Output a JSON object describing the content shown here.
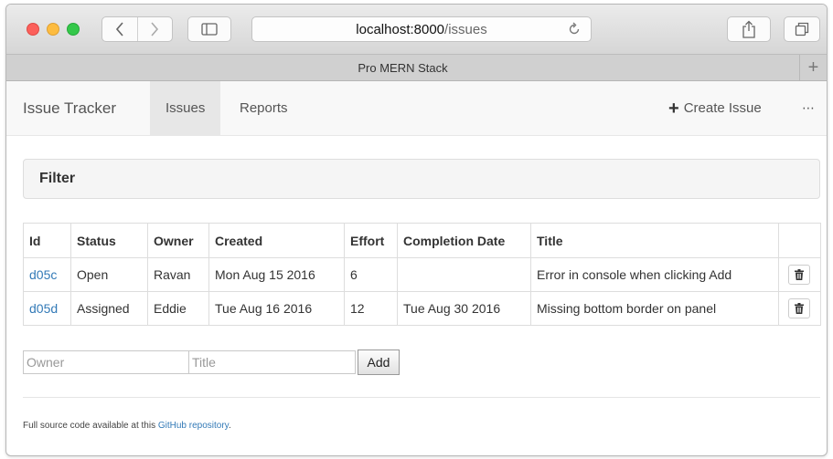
{
  "browser": {
    "url_host": "localhost:8000",
    "url_path": "/issues",
    "tab_title": "Pro MERN Stack",
    "new_tab": "+"
  },
  "app": {
    "brand": "Issue Tracker",
    "nav": {
      "issues": "Issues",
      "reports": "Reports",
      "create_issue": "Create Issue",
      "more": "⋯"
    },
    "filter": {
      "title": "Filter"
    },
    "table": {
      "headers": [
        "Id",
        "Status",
        "Owner",
        "Created",
        "Effort",
        "Completion Date",
        "Title"
      ],
      "rows": [
        {
          "id": "d05c",
          "status": "Open",
          "owner": "Ravan",
          "created": "Mon Aug 15 2016",
          "effort": "6",
          "completion_date": "",
          "title": "Error in console when clicking Add"
        },
        {
          "id": "d05d",
          "status": "Assigned",
          "owner": "Eddie",
          "created": "Tue Aug 16 2016",
          "effort": "12",
          "completion_date": "Tue Aug 30 2016",
          "title": "Missing bottom border on panel"
        }
      ]
    },
    "add_form": {
      "owner_placeholder": "Owner",
      "title_placeholder": "Title",
      "add_label": "Add"
    },
    "footer": {
      "text": "Full source code available at this ",
      "link": "GitHub repository",
      "suffix": "."
    }
  },
  "colors": {
    "link": "#337ab7",
    "navbar_bg": "#f8f8f8",
    "active_tab_bg": "#e7e7e7",
    "panel_bg": "#f5f5f5"
  },
  "icons": [
    "back-arrow-icon",
    "forward-arrow-icon",
    "sidebar-icon",
    "reload-icon",
    "share-icon",
    "tabs-icon",
    "plus-icon",
    "trash-icon"
  ]
}
